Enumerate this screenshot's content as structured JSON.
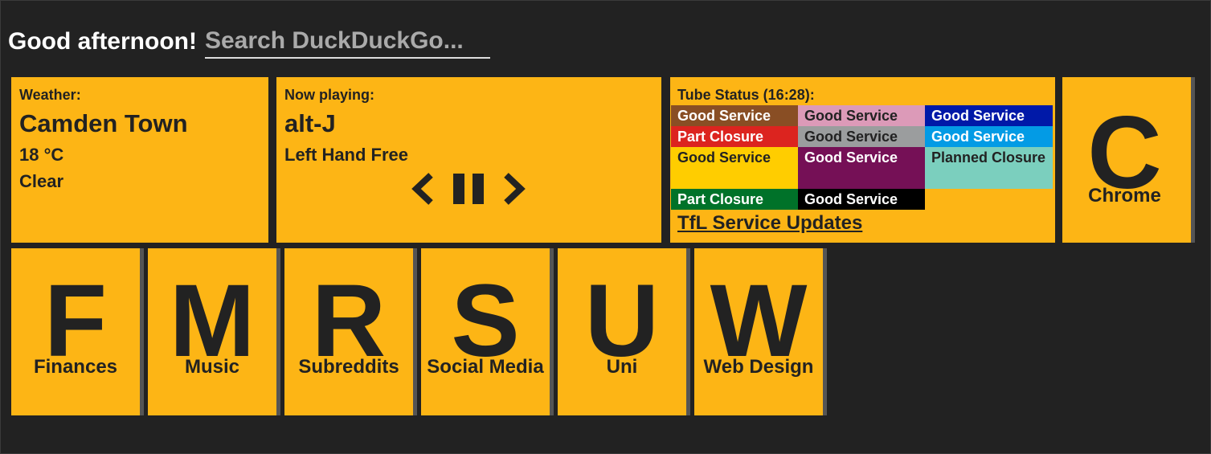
{
  "header": {
    "greeting": "Good afternoon!",
    "search_placeholder": "Search DuckDuckGo..."
  },
  "weather": {
    "heading": "Weather:",
    "location": "Camden Town",
    "temperature": "18 °C",
    "condition": "Clear"
  },
  "music": {
    "heading": "Now playing:",
    "artist": "alt-J",
    "track": "Left Hand Free",
    "controls": [
      "previous-icon",
      "pause-icon",
      "next-icon"
    ]
  },
  "tube": {
    "heading": "Tube Status (16:28):",
    "lines": [
      {
        "status": "Good Service",
        "bg": "#894e24",
        "fg": "#ffffff"
      },
      {
        "status": "Good Service",
        "bg": "#dc9ab8",
        "fg": "#222222"
      },
      {
        "status": "Good Service",
        "bg": "#0019a8",
        "fg": "#ffffff"
      },
      {
        "status": "Part Closure",
        "bg": "#dc241f",
        "fg": "#ffffff"
      },
      {
        "status": "Good Service",
        "bg": "#9b9d9e",
        "fg": "#222222"
      },
      {
        "status": "Good Service",
        "bg": "#039be5",
        "fg": "#ffffff"
      },
      {
        "status": "Good Service",
        "bg": "#ffcd00",
        "fg": "#222222"
      },
      {
        "status": "Good Service",
        "bg": "#751056",
        "fg": "#ffffff"
      },
      {
        "status": "Planned Closure",
        "bg": "#7bcfbe",
        "fg": "#222222"
      },
      {
        "status": "Part Closure",
        "bg": "#007229",
        "fg": "#ffffff"
      },
      {
        "status": "Good Service",
        "bg": "#000000",
        "fg": "#ffffff"
      }
    ],
    "link": "TfL Service Updates"
  },
  "shortcuts": [
    {
      "letter": "C",
      "name": "Chrome"
    },
    {
      "letter": "F",
      "name": "Finances"
    },
    {
      "letter": "M",
      "name": "Music"
    },
    {
      "letter": "R",
      "name": "Subreddits"
    },
    {
      "letter": "S",
      "name": "Social Media"
    },
    {
      "letter": "U",
      "name": "Uni"
    },
    {
      "letter": "W",
      "name": "Web Design"
    }
  ],
  "colors": {
    "background": "#222222",
    "tile": "#fdb515",
    "text": "#222222"
  }
}
